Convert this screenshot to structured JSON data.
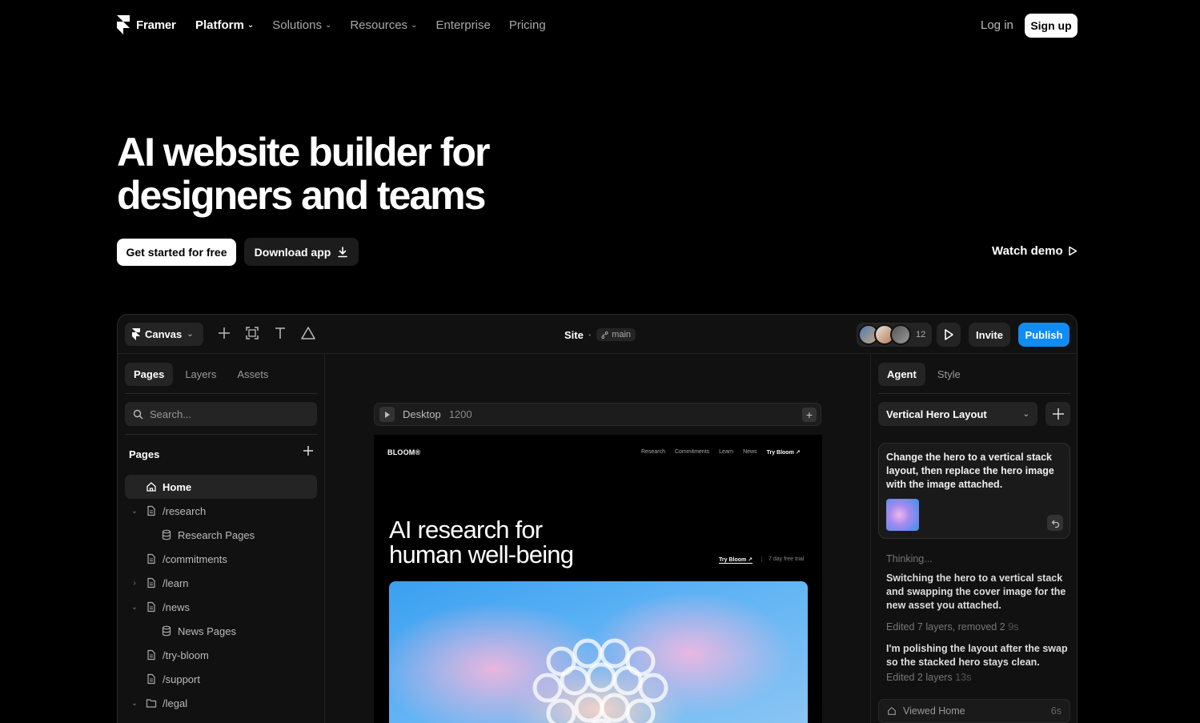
{
  "nav": {
    "brand": "Framer",
    "items": [
      {
        "label": "Platform",
        "chevron": true,
        "active": true
      },
      {
        "label": "Solutions",
        "chevron": true
      },
      {
        "label": "Resources",
        "chevron": true
      },
      {
        "label": "Enterprise"
      },
      {
        "label": "Pricing"
      }
    ],
    "login": "Log in",
    "signup": "Sign up"
  },
  "hero": {
    "title_line1": "AI website builder for",
    "title_line2": "designers and teams",
    "primary_cta": "Get started for free",
    "secondary_cta": "Download app",
    "watch_demo": "Watch demo"
  },
  "app": {
    "toolbar": {
      "canvas_label": "Canvas",
      "site_label": "Site",
      "separator": "·",
      "branch": "main",
      "collaborator_count": "12",
      "invite": "Invite",
      "publish": "Publish"
    },
    "left": {
      "tabs": [
        "Pages",
        "Layers",
        "Assets"
      ],
      "search_placeholder": "Search...",
      "pages_heading": "Pages",
      "tree": [
        {
          "label": "Home",
          "type": "home",
          "active": true
        },
        {
          "label": "/research",
          "type": "page",
          "caret": "open"
        },
        {
          "label": "Research Pages",
          "type": "db",
          "indent": 2
        },
        {
          "label": "/commitments",
          "type": "page"
        },
        {
          "label": "/learn",
          "type": "page",
          "caret": "closed"
        },
        {
          "label": "/news",
          "type": "page",
          "caret": "open"
        },
        {
          "label": "News Pages",
          "type": "db",
          "indent": 2
        },
        {
          "label": "/try-bloom",
          "type": "page"
        },
        {
          "label": "/support",
          "type": "page"
        },
        {
          "label": "/legal",
          "type": "folder",
          "caret": "open"
        }
      ]
    },
    "canvas": {
      "breakpoint": "Desktop",
      "width": "1200",
      "site": {
        "brand": "BLOOM®",
        "nav": [
          "Research",
          "Commitments",
          "Learn",
          "News"
        ],
        "nav_cta": "Try Bloom ↗",
        "title_line1": "AI research for",
        "title_line2": "human well-being",
        "try_link": "Try Bloom ↗",
        "trial_text": "7 day free trial"
      }
    },
    "right": {
      "tabs": [
        "Agent",
        "Style"
      ],
      "thread": "Vertical Hero Layout",
      "user_message": "Change the hero to a vertical stack layout, then replace the hero image with the image attached.",
      "thinking": "Thinking...",
      "response1": "Switching the hero to a vertical stack and swapping the cover image for the new asset you attached.",
      "edit1": "Edited 7 layers, removed 2",
      "edit1_time": "9s",
      "response2": "I'm polishing the layout after the swap so the stacked hero stays clean.",
      "edit2": "Edited 2 layers",
      "edit2_time": "13s",
      "viewed": "Viewed Home",
      "viewed_time": "6s"
    }
  },
  "colors": {
    "background": "#000000",
    "panel": "#111111",
    "publish": "#0f8cf6"
  }
}
